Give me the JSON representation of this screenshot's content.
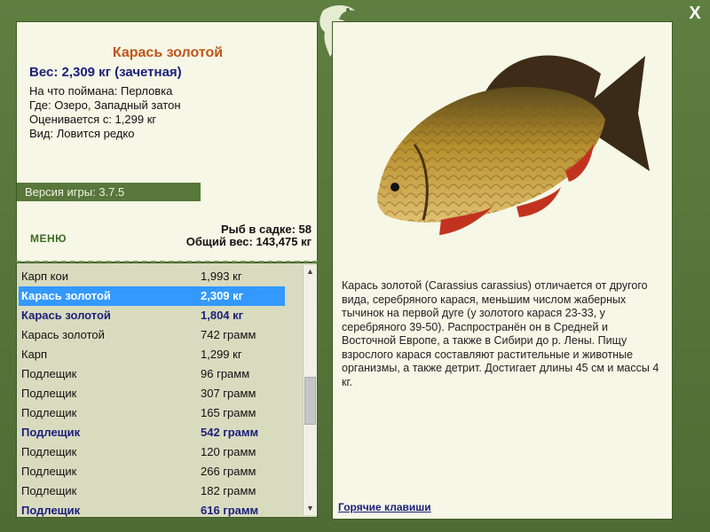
{
  "close_label": "X",
  "catch": {
    "title": "Карась золотой",
    "weight": "Вес: 2,309 кг (зачетная)",
    "bait": "На что поймана: Перловка",
    "place": "Где: Озеро, Западный затон",
    "value": "Оценивается с: 1,299 кг",
    "kind": "Вид: Ловится редко"
  },
  "version": "Версия игры: 3.7.5",
  "menu_label": "МЕНЮ",
  "keepnet": {
    "count": "Рыб в садке: 58",
    "total_weight": "Общий вес: 143,475 кг"
  },
  "list": [
    {
      "name": "Карп кои",
      "weight": "1,993 кг",
      "style": "normal"
    },
    {
      "name": "Карась золотой",
      "weight": "2,309 кг",
      "style": "selected"
    },
    {
      "name": "Карась золотой",
      "weight": "1,804 кг",
      "style": "bold"
    },
    {
      "name": "Карась золотой",
      "weight": "742 грамм",
      "style": "normal"
    },
    {
      "name": "Карп",
      "weight": "1,299 кг",
      "style": "normal"
    },
    {
      "name": "Подлещик",
      "weight": "96 грамм",
      "style": "normal"
    },
    {
      "name": "Подлещик",
      "weight": "307 грамм",
      "style": "normal"
    },
    {
      "name": "Подлещик",
      "weight": "165 грамм",
      "style": "normal"
    },
    {
      "name": "Подлещик",
      "weight": "542 грамм",
      "style": "bold"
    },
    {
      "name": "Подлещик",
      "weight": "120 грамм",
      "style": "normal"
    },
    {
      "name": "Подлещик",
      "weight": "266 грамм",
      "style": "normal"
    },
    {
      "name": "Подлещик",
      "weight": "182 грамм",
      "style": "normal"
    },
    {
      "name": "Подлещик",
      "weight": "616 грамм",
      "style": "bold"
    }
  ],
  "description": "Карась золотой (Carassius carassius) отличается от другого вида, серебряного карася, меньшим числом жаберных тычинок на первой дуге (у золотого карася 23-33, у серебряного 39-50). Распространён он в Средней и Восточной Европе, а также в Сибири до р. Лены. Пищу взрослого карася составляют растительные и животные организмы, а также детрит. Достигает длины 45 см и массы 4 кг.",
  "hotkeys_label": "Горячие клавиши",
  "colors": {
    "frame": "#55743a",
    "panel": "#f6f7e6",
    "title": "#c0541a",
    "emphasis": "#1a1f7a",
    "selection": "#3399ff"
  },
  "icons": {
    "logo": "fish-logo-icon",
    "close": "close-icon",
    "scroll_up": "chevron-up-icon",
    "scroll_down": "chevron-down-icon"
  }
}
